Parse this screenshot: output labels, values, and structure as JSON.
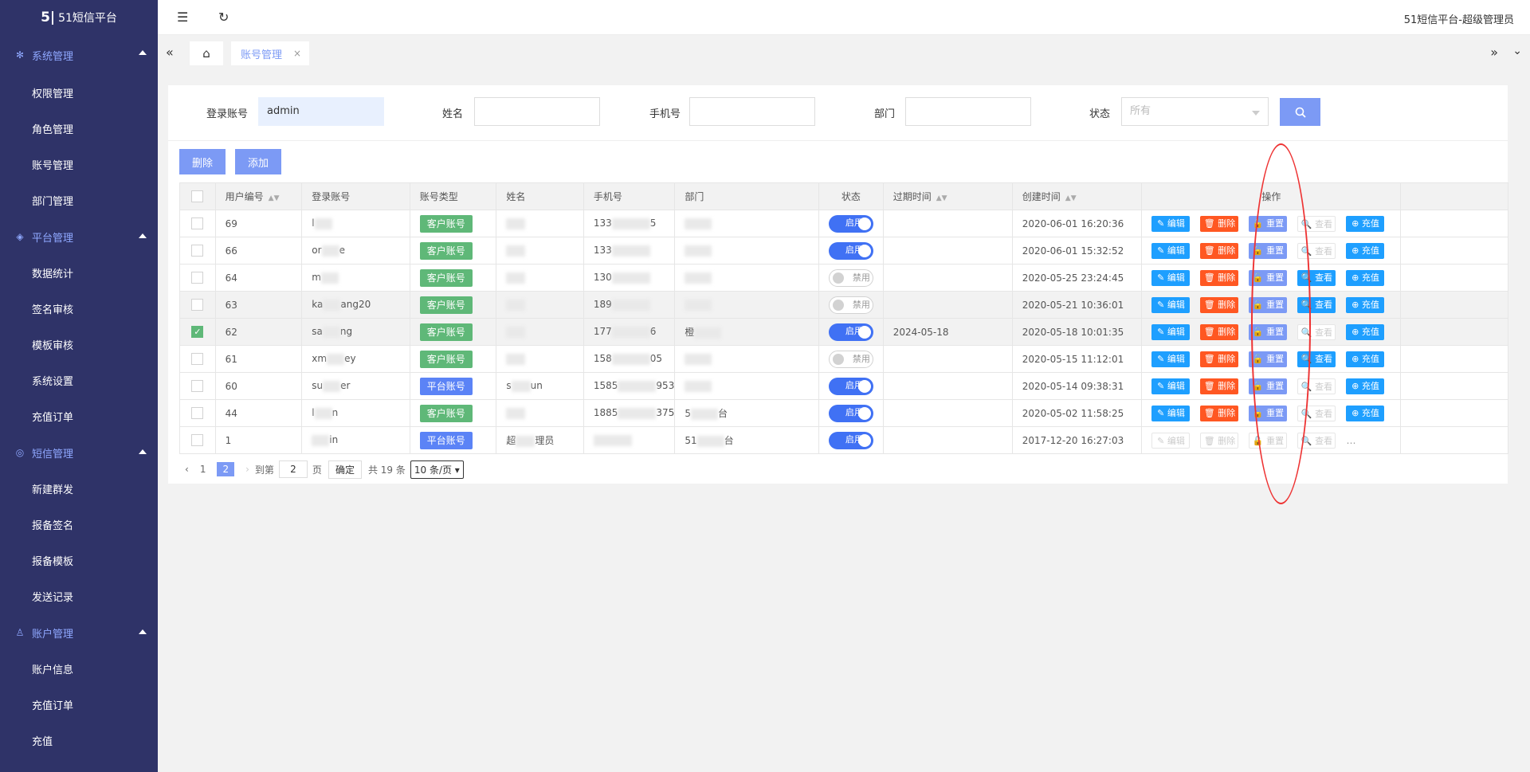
{
  "brand": {
    "logo": "5|",
    "title": "51短信平台"
  },
  "sidebar": {
    "groups": [
      {
        "label": "系统管理",
        "icon": "gear-icon",
        "items": [
          "权限管理",
          "角色管理",
          "账号管理",
          "部门管理"
        ]
      },
      {
        "label": "平台管理",
        "icon": "layers-icon",
        "items": [
          "数据统计",
          "签名审核",
          "模板审核",
          "系统设置",
          "充值订单"
        ]
      },
      {
        "label": "短信管理",
        "icon": "message-icon",
        "items": [
          "新建群发",
          "报备签名",
          "报备模板",
          "发送记录"
        ]
      },
      {
        "label": "账户管理",
        "icon": "user-icon",
        "items": [
          "账户信息",
          "充值订单",
          "充值"
        ]
      }
    ]
  },
  "topbar": {
    "user": "51短信平台-超级管理员",
    "menu_icon": "☰",
    "refresh_icon": "↻"
  },
  "tabs": {
    "home_icon": "⌂",
    "active": "账号管理",
    "close": "×",
    "left": "«",
    "right": "»",
    "down": "⌄"
  },
  "filter": {
    "login_label": "登录账号",
    "login_value": "admin",
    "name_label": "姓名",
    "phone_label": "手机号",
    "dept_label": "部门",
    "status_label": "状态",
    "status_value": "所有"
  },
  "actions": {
    "delete": "删除",
    "add": "添加"
  },
  "table": {
    "headers": {
      "id": "用户编号",
      "login": "登录账号",
      "type": "账号类型",
      "name": "姓名",
      "phone": "手机号",
      "dept": "部门",
      "status": "状态",
      "expire": "过期时间",
      "created": "创建时间",
      "ops": "操作"
    },
    "ops_labels": {
      "edit": "✎ 编辑",
      "delete": "🗑 删除",
      "reset": "🔓 重置",
      "view": "🔍 查看",
      "recharge": "⊕ 充值"
    },
    "rows": [
      {
        "id": "69",
        "login": "l",
        "type": "客户账号",
        "name": "",
        "phone": "133",
        "phone2": "5",
        "dept": "",
        "status": "启用",
        "expire": "",
        "created": "2020-06-01 16:20:36"
      },
      {
        "id": "66",
        "login": "or",
        "login2": "e",
        "type": "客户账号",
        "name": "",
        "phone": "133",
        "phone2": "",
        "dept": "",
        "status": "启用",
        "expire": "",
        "created": "2020-06-01 15:32:52"
      },
      {
        "id": "64",
        "login": "m",
        "type": "客户账号",
        "name": "",
        "phone": "130",
        "phone2": "",
        "dept": "",
        "status": "禁用",
        "expire": "",
        "created": "2020-05-25 23:24:45"
      },
      {
        "id": "63",
        "login": "ka",
        "login2": "ang20",
        "type": "客户账号",
        "name": "",
        "phone": "189",
        "phone2": "",
        "dept": "",
        "status": "禁用",
        "expire": "",
        "created": "2020-05-21 10:36:01"
      },
      {
        "id": "62",
        "login": "sa",
        "login2": "ng",
        "type": "客户账号",
        "name": "",
        "phone": "177",
        "phone2": "6",
        "dept": "橙",
        "status": "启用",
        "expire": "2024-05-18",
        "created": "2020-05-18 10:01:35"
      },
      {
        "id": "61",
        "login": "xm",
        "login2": "ey",
        "type": "客户账号",
        "name": "",
        "phone": "158",
        "phone2": "05",
        "dept": "",
        "status": "禁用",
        "expire": "",
        "created": "2020-05-15 11:12:01"
      },
      {
        "id": "60",
        "login": "su",
        "login2": "er",
        "type": "平台账号",
        "name": "s",
        "name2": "un",
        "phone": "1585",
        "phone2": "953",
        "dept": "",
        "status": "启用",
        "expire": "",
        "created": "2020-05-14 09:38:31"
      },
      {
        "id": "44",
        "login": "l",
        "login2": "n",
        "type": "客户账号",
        "name": "",
        "phone": "1885",
        "phone2": "375",
        "dept": "5",
        "dept2": "台",
        "status": "启用",
        "expire": "",
        "created": "2020-05-02 11:58:25"
      },
      {
        "id": "1",
        "login": "",
        "login2": "in",
        "type": "平台账号",
        "name": "超",
        "name2": "理员",
        "phone": "",
        "phone2": "",
        "dept": "51",
        "dept2": "台",
        "status": "启用",
        "expire": "",
        "created": "2017-12-20 16:27:03"
      }
    ]
  },
  "pager": {
    "prev": "‹",
    "p1": "1",
    "p2": "2",
    "next": "›",
    "goto": "到第",
    "page_input": "2",
    "page_unit": "页",
    "ok": "确定",
    "total": "共 19 条",
    "size": "10 条/页 ▾",
    "more": "…"
  },
  "colors": {
    "sidebar": "#2f3368",
    "accent": "#7c9af5",
    "customer": "#5fb878",
    "platform": "#5b83f6",
    "edit": "#1e9fff",
    "delete": "#ff5722",
    "reset": "#7c9af5",
    "view": "#1e9fff",
    "recharge": "#1e9fff"
  }
}
